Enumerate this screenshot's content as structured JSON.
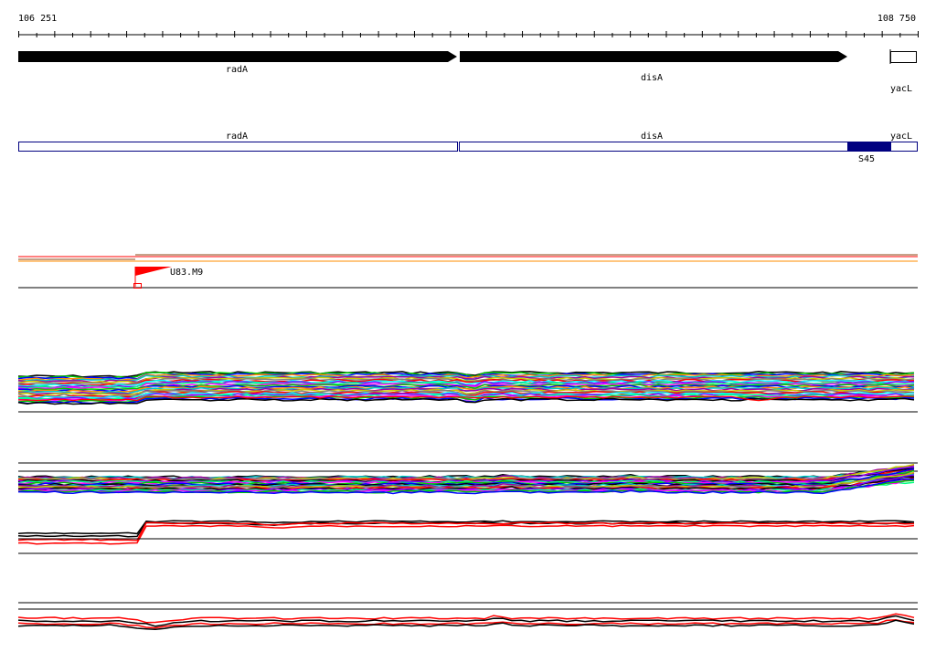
{
  "ruler": {
    "start_label": "106 251",
    "end_label": "108 750"
  },
  "genes": [
    {
      "name": "radA",
      "kind": "arrow"
    },
    {
      "name": "disA",
      "kind": "arrow"
    },
    {
      "name": "yacL",
      "kind": "partial"
    }
  ],
  "gene_boxes": [
    {
      "name": "radA"
    },
    {
      "name": "disA"
    },
    {
      "name": "yacL"
    }
  ],
  "segment_label": "S45",
  "marker_label": "U83.M9",
  "colors": {
    "black": "#000000",
    "red": "#ff0000",
    "navy": "#000080",
    "trace_palette": [
      "#ff00ff",
      "#00c800",
      "#0000ff",
      "#ff8c00",
      "#00c8c8",
      "#a000a0",
      "#c8c800",
      "#808080",
      "#ff0000",
      "#00ffff",
      "#8000ff",
      "#00ff80"
    ]
  }
}
